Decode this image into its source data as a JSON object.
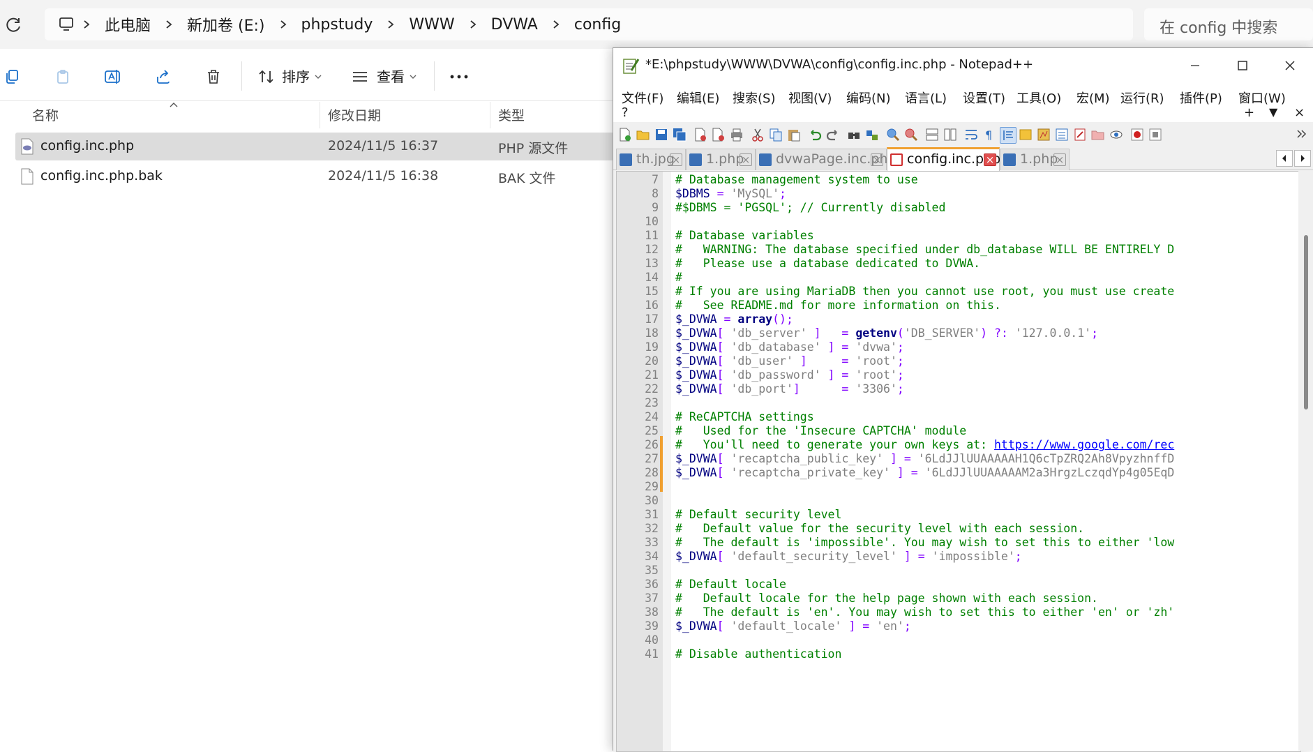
{
  "explorer": {
    "breadcrumb": [
      "此电脑",
      "新加卷 (E:)",
      "phpstudy",
      "WWW",
      "DVWA",
      "config"
    ],
    "search_placeholder": "在 config 中搜索",
    "toolbar": {
      "sort_label": "排序",
      "view_label": "查看",
      "icons": [
        "copy-icon",
        "paste-icon",
        "rename-icon",
        "share-icon",
        "delete-icon",
        "more-icon"
      ]
    },
    "columns": {
      "name": "名称",
      "date": "修改日期",
      "type": "类型"
    },
    "files": [
      {
        "name": "config.inc.php",
        "date": "2024/11/5 16:37",
        "type": "PHP 源文件",
        "selected": true
      },
      {
        "name": "config.inc.php.bak",
        "date": "2024/11/5 16:38",
        "type": "BAK 文件",
        "selected": false
      }
    ]
  },
  "npp": {
    "title": "*E:\\phpstudy\\WWW\\DVWA\\config\\config.inc.php - Notepad++",
    "menu": [
      "文件(F)",
      "编辑(E)",
      "搜索(S)",
      "视图(V)",
      "编码(N)",
      "语言(L)",
      "设置(T)",
      "工具(O)",
      "宏(M)",
      "运行(R)",
      "插件(P)",
      "窗口(W)",
      "?"
    ],
    "menu_right": [
      "+",
      "▼",
      "×"
    ],
    "tabs": [
      {
        "label": "th.jpg",
        "active": false
      },
      {
        "label": "1.php",
        "active": false
      },
      {
        "label": "dvwaPage.inc.php",
        "active": false
      },
      {
        "label": "config.inc.php",
        "active": true
      },
      {
        "label": "1.php",
        "active": false
      }
    ],
    "accent_color": "#f0a030",
    "first_line": 7,
    "lines": [
      [
        [
          "c-cmt",
          "# Database management system to use"
        ]
      ],
      [
        [
          "c-var",
          "$DBMS"
        ],
        [
          "c-op",
          " = "
        ],
        [
          "c-str",
          "'MySQL'"
        ],
        [
          "c-op",
          ";"
        ]
      ],
      [
        [
          "c-cmt",
          "#$DBMS = 'PGSQL'; // Currently disabled"
        ]
      ],
      [],
      [
        [
          "c-cmt",
          "# Database variables"
        ]
      ],
      [
        [
          "c-cmt",
          "#   WARNING: The database specified under db_database WILL BE ENTIRELY D"
        ]
      ],
      [
        [
          "c-cmt",
          "#   Please use a database dedicated to DVWA."
        ]
      ],
      [
        [
          "c-cmt",
          "#"
        ]
      ],
      [
        [
          "c-cmt",
          "# If you are using MariaDB then you cannot use root, you must use create"
        ]
      ],
      [
        [
          "c-cmt",
          "#   See README.md for more information on this."
        ]
      ],
      [
        [
          "c-var",
          "$_DVWA"
        ],
        [
          "c-op",
          " = "
        ],
        [
          "c-fn",
          "array"
        ],
        [
          "c-op",
          "();"
        ]
      ],
      [
        [
          "c-var",
          "$_DVWA"
        ],
        [
          "c-op",
          "[ "
        ],
        [
          "c-str",
          "'db_server'"
        ],
        [
          "c-op",
          " ]   = "
        ],
        [
          "c-fn",
          "getenv"
        ],
        [
          "c-op",
          "("
        ],
        [
          "c-str",
          "'DB_SERVER'"
        ],
        [
          "c-op",
          ") ?: "
        ],
        [
          "c-str",
          "'127.0.0.1'"
        ],
        [
          "c-op",
          ";"
        ]
      ],
      [
        [
          "c-var",
          "$_DVWA"
        ],
        [
          "c-op",
          "[ "
        ],
        [
          "c-str",
          "'db_database'"
        ],
        [
          "c-op",
          " ] = "
        ],
        [
          "c-str",
          "'dvwa'"
        ],
        [
          "c-op",
          ";"
        ]
      ],
      [
        [
          "c-var",
          "$_DVWA"
        ],
        [
          "c-op",
          "[ "
        ],
        [
          "c-str",
          "'db_user'"
        ],
        [
          "c-op",
          " ]     = "
        ],
        [
          "c-str",
          "'root'"
        ],
        [
          "c-op",
          ";"
        ]
      ],
      [
        [
          "c-var",
          "$_DVWA"
        ],
        [
          "c-op",
          "[ "
        ],
        [
          "c-str",
          "'db_password'"
        ],
        [
          "c-op",
          " ] = "
        ],
        [
          "c-str",
          "'root'"
        ],
        [
          "c-op",
          ";"
        ]
      ],
      [
        [
          "c-var",
          "$_DVWA"
        ],
        [
          "c-op",
          "[ "
        ],
        [
          "c-str",
          "'db_port'"
        ],
        [
          "c-op",
          "]      = "
        ],
        [
          "c-str",
          "'3306'"
        ],
        [
          "c-op",
          ";"
        ]
      ],
      [],
      [
        [
          "c-cmt",
          "# ReCAPTCHA settings"
        ]
      ],
      [
        [
          "c-cmt",
          "#   Used for the 'Insecure CAPTCHA' module"
        ]
      ],
      [
        [
          "c-cmt",
          "#   You'll need to generate your own keys at: "
        ],
        [
          "c-url",
          "https://www.google.com/rec"
        ]
      ],
      [
        [
          "c-var",
          "$_DVWA"
        ],
        [
          "c-op",
          "[ "
        ],
        [
          "c-str",
          "'recaptcha_public_key'"
        ],
        [
          "c-op",
          " ] = "
        ],
        [
          "c-str",
          "'6LdJJlUUAAAAAH1Q6cTpZRQ2Ah8VpyzhnffD"
        ]
      ],
      [
        [
          "c-var",
          "$_DVWA"
        ],
        [
          "c-op",
          "[ "
        ],
        [
          "c-str",
          "'recaptcha_private_key'"
        ],
        [
          "c-op",
          " ] = "
        ],
        [
          "c-str",
          "'6LdJJlUUAAAAAM2a3HrgzLczqdYp4g05EqD"
        ]
      ],
      [],
      [],
      [
        [
          "c-cmt",
          "# Default security level"
        ]
      ],
      [
        [
          "c-cmt",
          "#   Default value for the security level with each session."
        ]
      ],
      [
        [
          "c-cmt",
          "#   The default is 'impossible'. You may wish to set this to either 'low"
        ]
      ],
      [
        [
          "c-var",
          "$_DVWA"
        ],
        [
          "c-op",
          "[ "
        ],
        [
          "c-str",
          "'default_security_level'"
        ],
        [
          "c-op",
          " ] = "
        ],
        [
          "c-str",
          "'impossible'"
        ],
        [
          "c-op",
          ";"
        ]
      ],
      [],
      [
        [
          "c-cmt",
          "# Default locale"
        ]
      ],
      [
        [
          "c-cmt",
          "#   Default locale for the help page shown with each session."
        ]
      ],
      [
        [
          "c-cmt",
          "#   The default is 'en'. You may wish to set this to either 'en' or 'zh'"
        ]
      ],
      [
        [
          "c-var",
          "$_DVWA"
        ],
        [
          "c-op",
          "[ "
        ],
        [
          "c-str",
          "'default_locale'"
        ],
        [
          "c-op",
          " ] = "
        ],
        [
          "c-str",
          "'en'"
        ],
        [
          "c-op",
          ";"
        ]
      ],
      [],
      [
        [
          "c-cmt",
          "# Disable authentication"
        ]
      ]
    ]
  }
}
